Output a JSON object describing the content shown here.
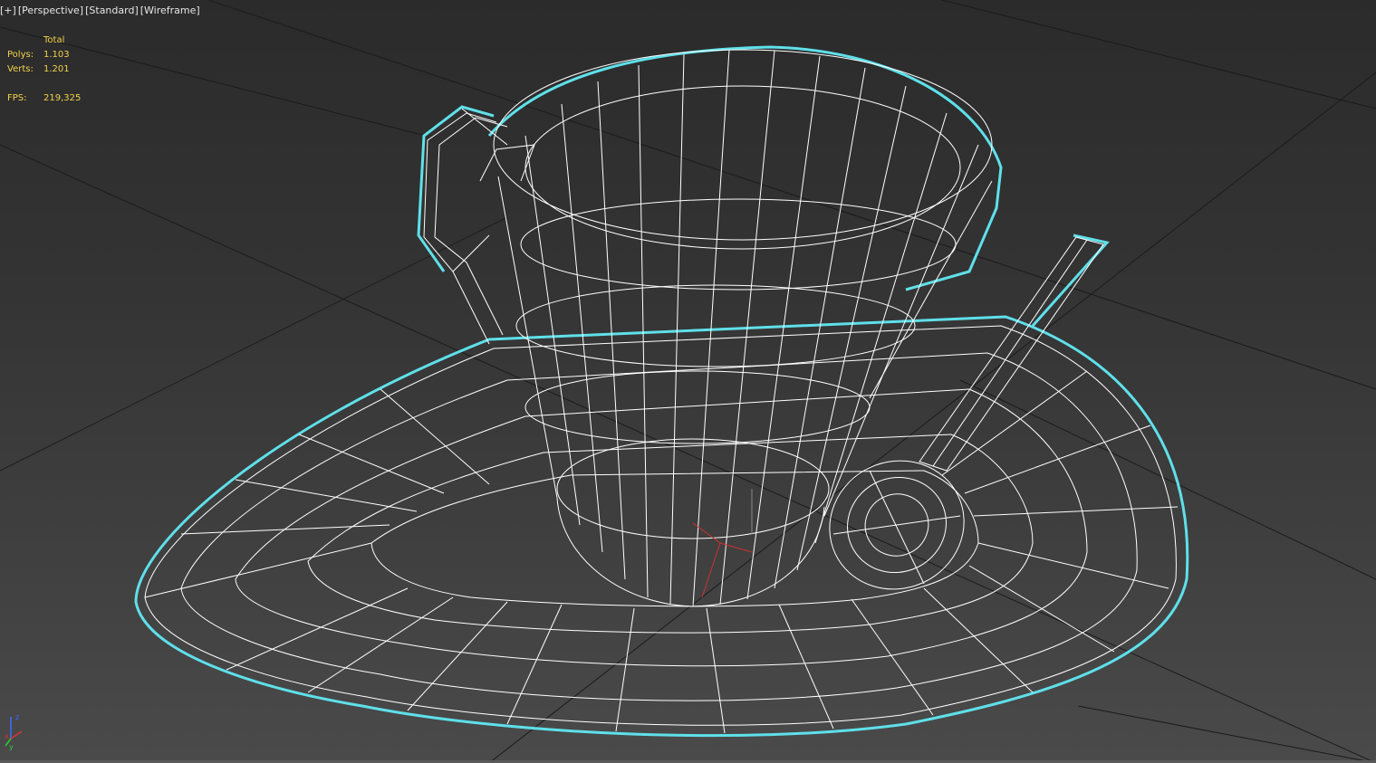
{
  "viewport": {
    "labels": {
      "plus": "[+]",
      "view": "[Perspective]",
      "shading": "[Standard]",
      "display": "[Wireframe]"
    },
    "stats": {
      "header": "Total",
      "polys_label": "Polys:",
      "polys_value": "1.103",
      "verts_label": "Verts:",
      "verts_value": "1.201",
      "fps_label": "FPS:",
      "fps_value": "219,325"
    },
    "gizmo": {
      "x": "x",
      "y": "y",
      "z": "z"
    }
  },
  "colors": {
    "selection_outline": "#5fe0ea",
    "wire": "#ffffff",
    "grid": "#1a1a1a",
    "stats_text": "#f2d24a",
    "axis_x": "#d33",
    "axis_y": "#3c3",
    "axis_z": "#36f"
  }
}
